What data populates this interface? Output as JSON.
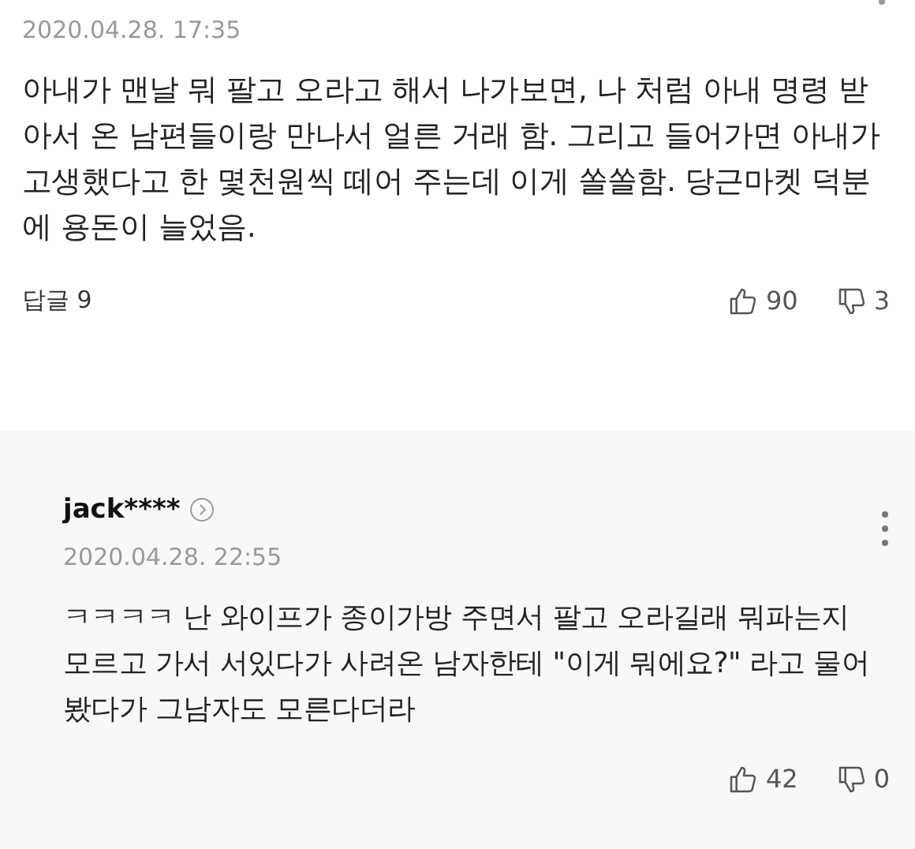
{
  "comment": {
    "date": "2020.04.28. 17:35",
    "body": "아내가 맨날 뭐 팔고 오라고 해서 나가보면, 나 처럼 아내 명령 받아서 온 남편들이랑 만나서 얼른 거래 함. 그리고 들어가면 아내가 고생했다고 한 몇천원씩 떼어 주는데 이게 쏠쏠함. 당근마켓 덕분에 용돈이 늘었음.",
    "replies": "답글 9",
    "likes": "90",
    "dislikes": "3"
  },
  "reply": {
    "user": "jack****",
    "date": "2020.04.28. 22:55",
    "body": "ㅋㅋㅋㅋ 난 와이프가 종이가방 주면서 팔고 오라길래 뭐파는지 모르고 가서 서있다가 사려온 남자한테 \"이게 뭐에요?\" 라고 물어봤다가 그남자도 모른다더라",
    "likes": "42",
    "dislikes": "0"
  }
}
